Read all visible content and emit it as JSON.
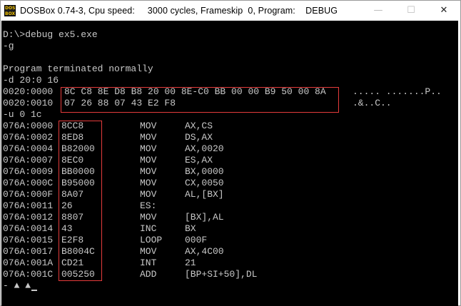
{
  "window": {
    "icon_label": "DOS BOX",
    "title": "DOSBox 0.74-3, Cpu speed:     3000 cycles, Frameskip  0, Program:    DEBUG",
    "minimize_glyph": "—",
    "maximize_glyph": "☐",
    "close_glyph": "✕"
  },
  "terminal": {
    "cmd_line": "D:\\>debug ex5.exe",
    "g_cmd": "-g",
    "blank": "",
    "terminated": "Program terminated normally",
    "d_cmd": "-d 20:0 16",
    "dump": [
      {
        "addr": "0020:0000",
        "bytes": "8C C8 8E D8 B8 20 00 8E-C0 BB 00 00 B9 50 00 8A",
        "ascii": "..... .......P.."
      },
      {
        "addr": "0020:0010",
        "bytes": "07 26 88 07 43 E2 F8",
        "ascii": ".&..C.."
      }
    ],
    "u_cmd": "-u 0 1c",
    "disasm": [
      {
        "addr": "076A:0000",
        "code": "8CC8",
        "mnem": "MOV",
        "ops": "AX,CS"
      },
      {
        "addr": "076A:0002",
        "code": "8ED8",
        "mnem": "MOV",
        "ops": "DS,AX"
      },
      {
        "addr": "076A:0004",
        "code": "B82000",
        "mnem": "MOV",
        "ops": "AX,0020"
      },
      {
        "addr": "076A:0007",
        "code": "8EC0",
        "mnem": "MOV",
        "ops": "ES,AX"
      },
      {
        "addr": "076A:0009",
        "code": "BB0000",
        "mnem": "MOV",
        "ops": "BX,0000"
      },
      {
        "addr": "076A:000C",
        "code": "B95000",
        "mnem": "MOV",
        "ops": "CX,0050"
      },
      {
        "addr": "076A:000F",
        "code": "8A07",
        "mnem": "MOV",
        "ops": "AL,[BX]"
      },
      {
        "addr": "076A:0011",
        "code": "26",
        "mnem": "ES:",
        "ops": ""
      },
      {
        "addr": "076A:0012",
        "code": "8807",
        "mnem": "MOV",
        "ops": "[BX],AL"
      },
      {
        "addr": "076A:0014",
        "code": "43",
        "mnem": "INC",
        "ops": "BX"
      },
      {
        "addr": "076A:0015",
        "code": "E2F8",
        "mnem": "LOOP",
        "ops": "000F"
      },
      {
        "addr": "076A:0017",
        "code": "B8004C",
        "mnem": "MOV",
        "ops": "AX,4C00"
      },
      {
        "addr": "076A:001A",
        "code": "CD21",
        "mnem": "INT",
        "ops": "21"
      },
      {
        "addr": "076A:001C",
        "code": "005250",
        "mnem": "ADD",
        "ops": "[BP+SI+50],DL"
      }
    ],
    "prompt_line": "- ▲ ▲"
  },
  "colors": {
    "terminal_bg": "#000000",
    "terminal_fg": "#c8c8c8",
    "highlight_box": "#e53b3b"
  }
}
